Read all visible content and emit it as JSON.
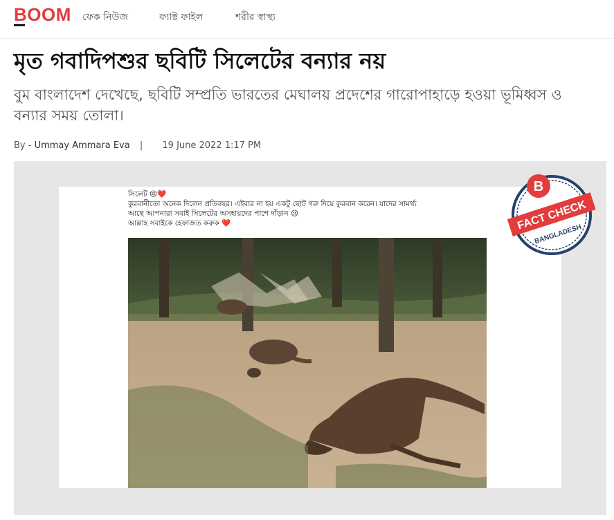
{
  "brand": {
    "logo_text": "BOOM",
    "accent": "#e23c3c"
  },
  "nav": {
    "items": [
      "ফেক নিউজ",
      "ফ্যাক্ট ফাইল",
      "শরীর স্বাস্থ্য"
    ]
  },
  "article": {
    "title": "মৃত গবাদিপশুর ছবিটি সিলেটের বন্যার নয়",
    "subtitle": "বুম বাংলাদেশ দেখেছে, ছবিটি সম্প্রতি ভারতের মেঘালয় প্রদেশের গারোপাহাড়ে হওয়া ভূমিধ্বস ও বন্যার সময় তোলা।",
    "byline_prefix": "By -",
    "author": "Ummay Ammara Eva",
    "separator": "|",
    "date": "19 June 2022 1:17 PM"
  },
  "hero": {
    "post_lines": [
      "সিলেট 😔❤️",
      "কুরবানীতো অনেক দিলেন প্রতিবছর। এইবার না হয় একটু ছোট গরু দিয়ে কুরবান করেন। যাদের সামর্থ্য",
      "আছে আপনারা সবাই সিলেটের অসহায়দের পাশে দাঁড়ান 😢",
      "আল্লাহ সবাইকে হেফাজত করুক ❤️"
    ],
    "stamp": {
      "letter": "B",
      "label": "FACT CHECK",
      "region": "BANGLADESH"
    }
  }
}
